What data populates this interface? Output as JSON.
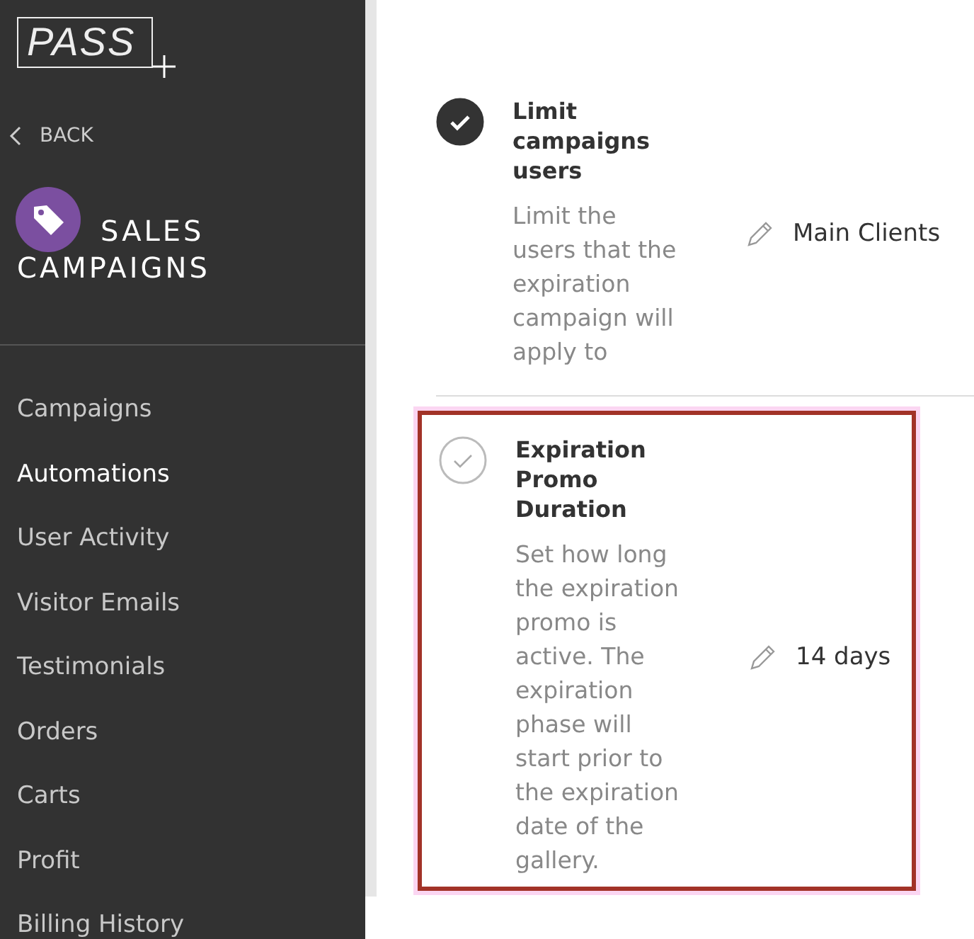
{
  "sidebar": {
    "logo": "PASS",
    "back": "BACK",
    "section_title": "SALES CAMPAIGNS",
    "items": [
      {
        "label": "Campaigns",
        "selected": false
      },
      {
        "label": "Automations",
        "selected": true
      },
      {
        "label": "User Activity",
        "selected": false
      },
      {
        "label": "Visitor Emails",
        "selected": false
      },
      {
        "label": "Testimonials",
        "selected": false
      },
      {
        "label": "Orders",
        "selected": false
      },
      {
        "label": "Carts",
        "selected": false
      },
      {
        "label": "Profit",
        "selected": false
      },
      {
        "label": "Billing History",
        "selected": false
      }
    ]
  },
  "settings": [
    {
      "title": "Limit campaigns users",
      "description": "Limit the users that the expiration campaign will apply to",
      "value": "Main Clients",
      "checked": true,
      "highlighted": false
    },
    {
      "title": "Expiration Promo Duration",
      "description": "Set how long the expiration promo is active. The expiration phase will start prior to the expiration date of the gallery.",
      "value": "14 days",
      "checked": false,
      "highlighted": true
    }
  ]
}
